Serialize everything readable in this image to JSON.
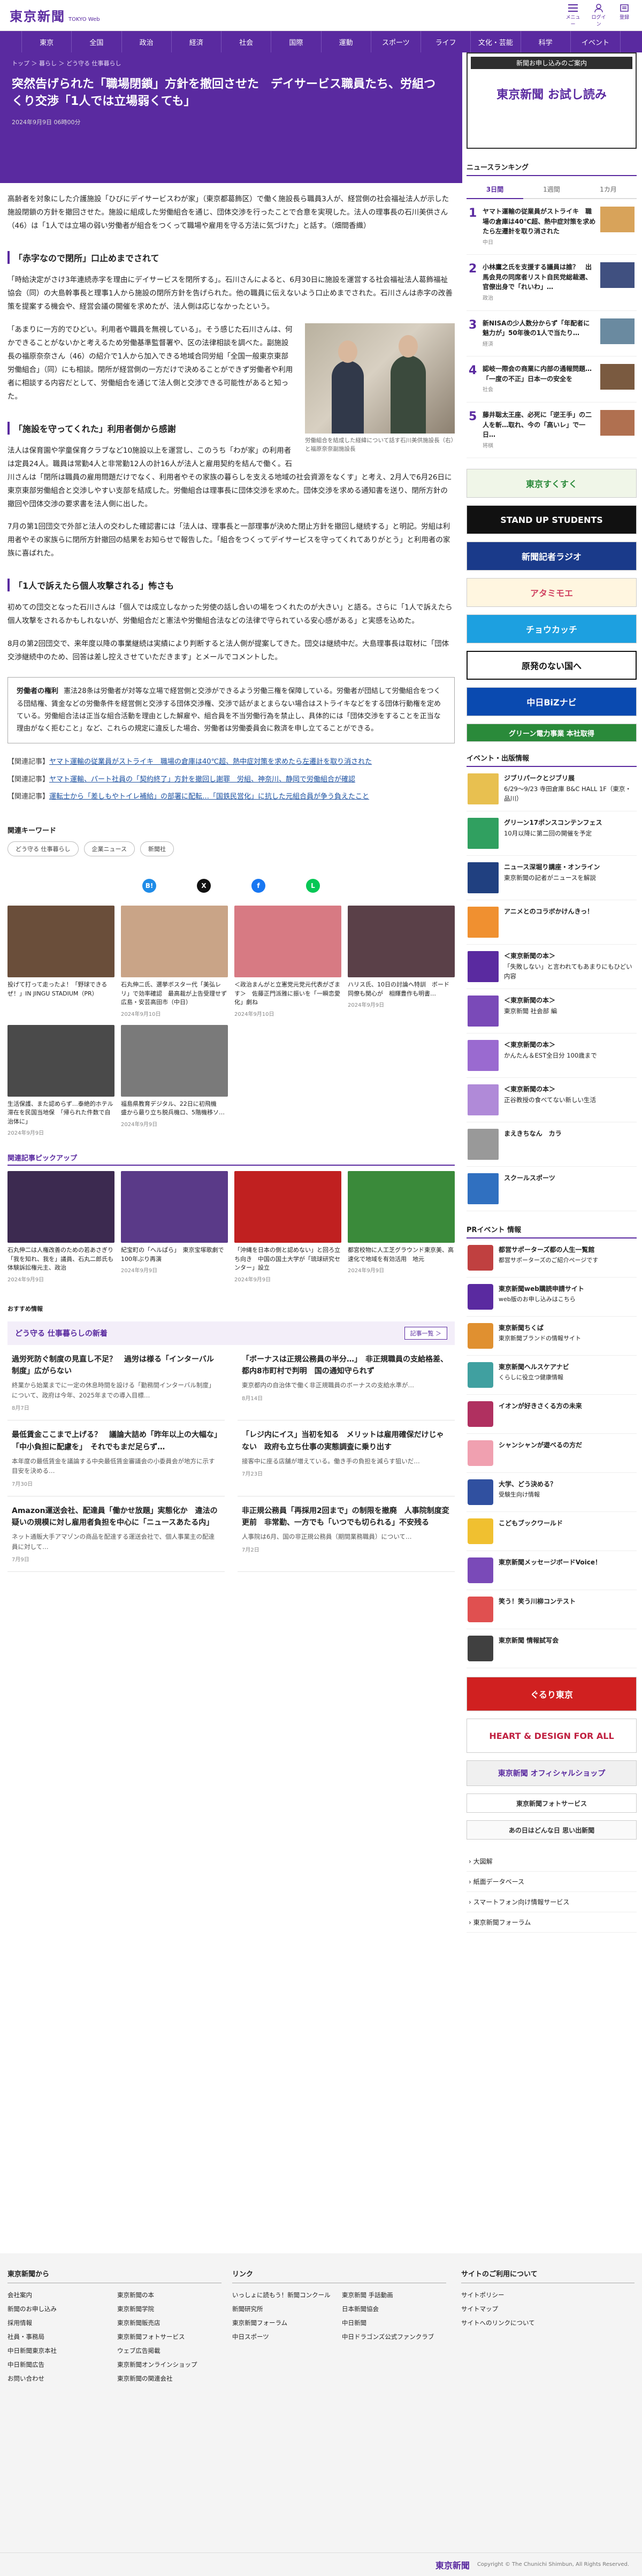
{
  "header": {
    "logo": "東京新聞",
    "logo_sub": "TOKYO Web",
    "icons": [
      {
        "name": "menu-icon",
        "label": "メニュー"
      },
      {
        "name": "login-icon",
        "label": "ログイン"
      },
      {
        "name": "user-icon",
        "label": "登録"
      }
    ]
  },
  "nav": [
    "東京",
    "全国",
    "政治",
    "経済",
    "社会",
    "国際",
    "運動",
    "スポーツ",
    "ライフ",
    "文化・芸能",
    "科学",
    "イベント"
  ],
  "breadcrumb": "トップ ＞ 暮らし ＞ どう守る 仕事暮らし",
  "article": {
    "title": "突然告げられた「職場閉鎖」方針を撤回させた　デイサービス職員たち、労組つくり交渉「1人では立場弱くても」",
    "date": "2024年9月9日 06時00分",
    "p1": "高齢者を対象にした介護施設「ひびにデイサービスわが家」（東京都葛飾区）で働く施設長ら職員3人が、経営側の社会福祉法人が示した施設閉鎖の方針を撤回させた。施設に組成した労働組合を通じ、団体交渉を行ったことで合意を実現した。法人の理事長の石川美供さん（46）は「1人では立場の弱い労働者が組合をつくって職場や雇用を守る方法に気づけた」と話す。（畑間香織）",
    "h_a": "「赤字なので閉所」口止めまでされて",
    "p2": "「時給決定がさけ3年連続赤字を理由にデイサービスを閉所する」。石川さんによると、6月30日に施設を運営する社会福祉法人葛飾福祉協会（同）の大島幹事長と理事1人から施設の閉所方針を告げられた。他の職員に伝えないよう口止めまでされた。石川さんは赤字の改善策を提案する機会や、経営会議の開催を求めたが、法人側は応じなかったという。",
    "p3": "「あまりに一方的でひどい。利用者や職員を無視している」。そう感じた石川さんは、何かできることがないかと考えるため労働基準監督署や、区の法律相談を調べた。副施設長の福原奈奈さん（46）の紹介で1人から加入できる地域合同労組「全国一般東京東部労働組合」（同）にも相談。閉所が経営側の一方だけで決めることができず労働者や利用者に相談する内容だとして、労働組合を通じて法人側と交渉できる可能性があると知った。",
    "h_b": "「施設を守ってくれた」利用者側から感謝",
    "p4": "法人は保育園や学童保育クラブなど10施設以上を運営し、このうち「わが家」の利用者は定員24人。職員は常勤4人と非常勤12人の計16人が法人と雇用契約を結んで働く。石川さんは「閉所は職員の雇用問題だけでなく、利用者やその家族の暮らしを支える地域の社会資源をなくす」と考え、2月人で6月26日に東京東部労働組合と交渉しやすい支部を結成した。労働組合は理事長に団体交渉を求めた。団体交渉を求める通知書を送り、閉所方針の撤回や団体交渉の要求書を法人側に出した。",
    "p5": "7月の第1回団交で外部と法人の交わした確認書には「法人は、理事長と一部理事が決めた閉止方針を撤回し継続する」と明記。労組は利用者やその家族らに閉所方針撤回の結果をお知らせで報告した。「組合をつくってデイサービスを守ってくれてありがとう」と利用者の家族に喜ばれた。",
    "h_c": "「1人で訴えたら個人攻撃される」怖さも",
    "p6": "初めての団交となった石川さんは「個人では成立しなかった労使の話し合いの場をつくれたのが大きい」と語る。さらに「1人で訴えたら個人攻撃をされるかもしれないが、労働組合だと憲法や労働組合法などの法律で守られている安心感がある」と実感を込めた。",
    "p7": "8月の第2回団交で、来年度以降の事業継続は実績により判断すると法人側が提案してきた。団交は継続中だ。大島理事長は取材に「団体交渉継続中のため、回答は差し控えさせていただきます」とメールでコメントした。",
    "photo_caption": "労働組合を結成した経緯について話す石川美供施設長（右）と福原奈奈副施設長",
    "note_title": "労働者の権利",
    "note_text": "憲法28条は労働者が対等な立場で経営側と交渉ができるよう労働三権を保障している。労働者が団結して労働組合をつくる団結権、賃金などの労働条件を経営側と交渉する団体交渉権、交渉で話がまとまらない場合はストライキなどをする団体行動権を定めている。労働組合法は正当な組合活動を理由とした解雇や、組合員を不当労働行為を禁止し、具体的には「団体交渉をすることを正当な理由がなく拒むこと」など、これらの規定に違反した場合、労働者は労働委員会に救済を申し立てることができる。",
    "related": [
      {
        "tag": "【関連記事】",
        "text": "ヤマト運輸の従業員がストライキ　職場の倉庫は40℃超、熱中症対策を求めたら左遷計を取り消された"
      },
      {
        "tag": "【関連記事】",
        "text": "ヤマト運輸、パート社員の「契約終了」方針を撤回し謝罪　労組、神奈川、静岡で労働組合が確認"
      },
      {
        "tag": "【関連記事】",
        "text": "運転士から「差しもやトイレ補給」の部署に配転…「国鉄民営化」に抗した元組合員が争う負えたこと"
      }
    ],
    "keywords_title": "関連キーワード",
    "keywords": [
      "どう守る 仕事暮らし",
      "企業ニュース",
      "新聞社"
    ]
  },
  "share": [
    {
      "name": "hatena-icon",
      "label": "B!",
      "color": "#1f8ce8"
    },
    {
      "name": "x-icon",
      "label": "X",
      "color": "#111111"
    },
    {
      "name": "facebook-icon",
      "label": "f",
      "color": "#1877f2"
    },
    {
      "name": "line-icon",
      "label": "L",
      "color": "#06c755"
    }
  ],
  "recommended": [
    {
      "t": "投げて打って走ったよ！「野球できるぜ！」IN JINGU STADIUM（PR）",
      "d": "",
      "c": "#6a4e3a"
    },
    {
      "t": "石丸伸二氏、選挙ボスター代「美弘レリ」で効率確認　最高裁が上告受理せず　広島・安芸高田市（中日）",
      "d": "2024年9月10日",
      "c": "#c9a487"
    },
    {
      "t": "＜政治まんがと立憲党元党元代表がざます＞　佐藤正門派雅に振いを「一瞬恋愛化」劇ね",
      "d": "2024年9月10日",
      "c": "#d77a83"
    },
    {
      "t": "ハリス氏、10日の討論へ特訓　ボード同僚も関心が　相輝豊作も明書…",
      "d": "2024年9月9日",
      "c": "#5a4048"
    },
    {
      "t": "生活保護、また認めらず…泰絶的ホテル滞在を民国当地保　「帰られた件数で自治体に」",
      "d": "2024年9月9日",
      "c": "#4a4a4a"
    },
    {
      "t": "福島県教育デジタル、22日に初飛機　盛から最り立ち脱兵機ロ、5階機移ソ…",
      "d": "2024年9月9日",
      "c": "#7a7a7a"
    }
  ],
  "pickup_title": "関連記事ピックアップ",
  "pickup": [
    {
      "t": "石丸伸二は人権改善のための若あさぎり「我を知れ、我を」議員、石丸二郎氏も　体験訴訟権元主、政治",
      "d": "2024年9月9日",
      "c": "#3c2a50"
    },
    {
      "t": "紀宝町の「へルぱら」　東京宝塚歌劇で100年ぶり再演",
      "d": "2024年9月9日",
      "c": "#5a3a88"
    },
    {
      "t": "「沖縄を日本の側と認めない」と回ろ立ち向き　中国の国土大学が「琉球研究センター」設立",
      "d": "2024年9月9日",
      "c": "#c02020"
    },
    {
      "t": "都宮校物に人工芝グラウンド東京美、高速化で地域を有効活用　地元",
      "d": "2024年9月9日",
      "c": "#3a8a3a"
    }
  ],
  "osusume": "おすすめ情報",
  "section": {
    "title": "どう守る 仕事暮らしの新着",
    "more": "記事一覧 ＞"
  },
  "section_articles": [
    {
      "ti": "過労死防ぐ制度の見直し不足？　過労は様る「インターバル制度」広がらない",
      "ex": "終業から始業までに一定の休息時間を設ける「勤務間インターバル制度」について、政府は今年、2025年までの導入目標…",
      "da": "8月7日"
    },
    {
      "ti": "「ボーナスは正規公務員の半分…」　非正規職員の支給格差、都内8市町村で判明　国の通知守られず",
      "ex": "東京都内の自治体で働く非正規職員のボーナスの支給水準が…",
      "da": "8月14日"
    },
    {
      "ti": "最低賃金ここまで上げる？　議論大詰め「昨年以上の大幅な」「中小負担に配慮を」　それでもまだ足らず…",
      "ex": "本年度の最低賃金を議論する中央最低賃金審議会の小委員会が地方に示す目安を決める…",
      "da": "7月30日"
    },
    {
      "ti": "「レジ内にイス」当初を知る　メリットは雇用確保だけじゃない　政府も立ち仕事の実態調査に乗り出す",
      "ex": "接客中に座る店舗が増えている。働き手の負担を減らす狙いだ…",
      "da": "7月23日"
    },
    {
      "ti": "Amazon運送会社、配達員「働かせ放題」実態化か　違法の疑いの規模に対し雇用者負担を中心に「ニュースあたる内」",
      "ex": "ネット通販大手アマゾンの商品を配達する運送会社で、個人事業主の配達員に対して…",
      "da": "7月9日"
    },
    {
      "ti": "非正規公務員「再採用2回まで」の制限を撤廃　人事院制度変更前　非常勤、一方でも「いつでも切られる」不安残る",
      "ex": "人事院は6月、国の非正規公務員（期間業務職員）について…",
      "da": "7月2日"
    }
  ],
  "sidebar": {
    "ad_title": "新聞お申し込みのご案内",
    "ad_text": "東京新聞 お試し読み",
    "ranking_title": "ニュースランキング",
    "ranking_tabs": [
      "3日間",
      "1週間",
      "1カ月"
    ],
    "ranking": [
      {
        "t": "ヤマト運輸の従業員がストライキ　職場の倉庫は40℃超、熱中症対策を求めたら左遷計を取り消された",
        "s": "中日",
        "c": "#d8a35a"
      },
      {
        "t": "小林鷹之氏を支援する議員は誰？　出馬会見の同席者リスト自民党総裁選、官僚出身で「れいわ」…",
        "s": "政治",
        "c": "#405080"
      },
      {
        "t": "新NISAの少人数分からず「年配者に魅力が」50年後の1人で当たり…",
        "s": "経済",
        "c": "#6a8aa0"
      },
      {
        "t": "認岐一際会の商業に内部の通報問題…「一度の不正」日本一の安全を",
        "s": "社会",
        "c": "#7a5a40"
      },
      {
        "t": "藤井聡太王座、必死に「逆王手」の二人を斬…取れ、今の「高いレ」で一日…",
        "s": "将棋",
        "c": "#b07050"
      }
    ],
    "banners": [
      {
        "text": "東京すくすく",
        "c": "#f0f6e8",
        "fg": "#2a8a3a"
      },
      {
        "text": "STAND UP STUDENTS",
        "c": "#111111",
        "fg": "#ffffff"
      },
      {
        "text": "新聞記者ラジオ",
        "c": "#1a3a8a",
        "fg": "#ffffff"
      },
      {
        "text": "アタミモエ",
        "c": "#fff6e0",
        "fg": "#d04060"
      },
      {
        "text": "チョウカッチ",
        "c": "#1da0e0",
        "fg": "#ffffff"
      },
      {
        "text": "原発のない国へ",
        "c": "#ffffff",
        "fg": "#111111"
      },
      {
        "text": "中日BiZナビ",
        "c": "#0a4ab0",
        "fg": "#ffffff"
      },
      {
        "text": "グリーン電力事業 本社取得",
        "c": "#2a8a3a",
        "fg": "#ffffff"
      }
    ],
    "events_title": "イベント・出版情報",
    "events": [
      {
        "b": "ジブリパークとジブリ展",
        "t": "6/29〜9/23 寺田倉庫 B&C HALL 1F（東京・品川）",
        "c": "#e8c050"
      },
      {
        "b": "グリーン17ポンスコンテンフェス",
        "t": "10月以降に第二回の開催を予定",
        "c": "#30a060"
      },
      {
        "b": "ニュース深堀り講座・オンライン",
        "t": "東京新聞の記者がニュースを解説",
        "c": "#204080"
      },
      {
        "b": "アニメとのコラボかけんきっ！",
        "t": "",
        "c": "#f09030"
      },
      {
        "b": "＜東京新聞の本＞",
        "t": "「失敗しない」と言われてもあまりにもひどい内容",
        "c": "#5a2aa0"
      },
      {
        "b": "＜東京新聞の本＞",
        "t": "東京新聞 社会部 編",
        "c": "#5a2aa0"
      },
      {
        "b": "＜東京新聞の本＞",
        "t": "かんたん＆EST全日分 100歳まで",
        "c": "#5a2aa0"
      },
      {
        "b": "＜東京新聞の本＞",
        "t": "正谷教授の食べてない新しい生活",
        "c": "#5a2aa0"
      },
      {
        "b": "まえきちなん　カラ",
        "t": "",
        "c": "#999999"
      },
      {
        "b": "スクールスポーツ",
        "t": "",
        "c": "#3070c0"
      }
    ],
    "pr_title": "PRイベント 情報",
    "pr": [
      {
        "b": "都営サポーターズ都の人生一覧館",
        "t": "都営サポーターズのご紹介ページです",
        "c": "#c04040"
      },
      {
        "b": "東京新聞web購読申請サイト",
        "t": "web版のお申し込みはこちら",
        "c": "#5a2aa0"
      },
      {
        "b": "東京新聞ちくば",
        "t": "東京新聞ブランドの情報サイト",
        "c": "#e09030"
      },
      {
        "b": "東京新聞ヘルスケアナビ",
        "t": "くらしに役立つ健康情報",
        "c": "#40a0a0"
      },
      {
        "b": "イオンが好きさくる方の未来",
        "t": "",
        "c": "#b03060"
      },
      {
        "b": "シャンシャンが遊べるの方だ",
        "t": "",
        "c": "#f0a0b0"
      },
      {
        "b": "大学、どう決める？",
        "t": "受験生向け情報",
        "c": "#3050a0"
      },
      {
        "b": "こどもブックワールド",
        "t": "",
        "c": "#f0c030"
      },
      {
        "b": "東京新聞メッセージボードVoice！",
        "t": "",
        "c": "#5a2aa0"
      },
      {
        "b": "笑う！笑う川柳コンテスト",
        "t": "",
        "c": "#e05050"
      },
      {
        "b": "東京新聞 情報試写会",
        "t": "",
        "c": "#404040"
      }
    ],
    "bottom_banners": [
      {
        "text": "ぐるり東京",
        "c": "#d02020",
        "fg": "#ffffff"
      },
      {
        "text": "HEART & DESIGN FOR ALL",
        "c": "#ffffff",
        "fg": "#c02040"
      },
      {
        "text": "東京新聞 オフィシャルショップ",
        "c": "#f0f0f0",
        "fg": "#5a2aa0"
      },
      {
        "text": "東京新聞フォトサービス",
        "c": "#ffffff",
        "fg": "#333333"
      },
      {
        "text": "あの日はどんな日 思い出新聞",
        "c": "#fafafa",
        "fg": "#333333"
      }
    ],
    "links": [
      "大図解",
      "紙面データベース",
      "スマートフォン向け情報サービス",
      "東京新聞フォーラム"
    ]
  },
  "footer": {
    "col1_title": "東京新聞から",
    "col1": [
      "会社案内",
      "東京新聞の本",
      "新聞のお申し込み",
      "東京新聞学院",
      "採用情報",
      "東京新聞販売店",
      "社員・事務局",
      "東京新聞フォトサービス",
      "中日新聞東京本社",
      "ウェブ広告掲載",
      "中日新聞広告",
      "東京新聞オンラインショップ",
      "お問い合わせ",
      "東京新聞の関連会社"
    ],
    "col2_title": "リンク",
    "col2": [
      "いっしょに読もう！新聞コンクール",
      "東京新聞 手話動画",
      "新聞研究所",
      "日本新聞協会",
      "東京新聞フォーラム",
      "中日新聞",
      "中日スポーツ",
      "中日ドラゴンズ公式ファンクラブ"
    ],
    "col3_title": "サイトのご利用について",
    "col3": [
      "サイトポリシー",
      "サイトマップ",
      "サイトへのリンクについて"
    ],
    "copyright": "Copyright © The Chunichi Shimbun, All Rights Reserved."
  }
}
